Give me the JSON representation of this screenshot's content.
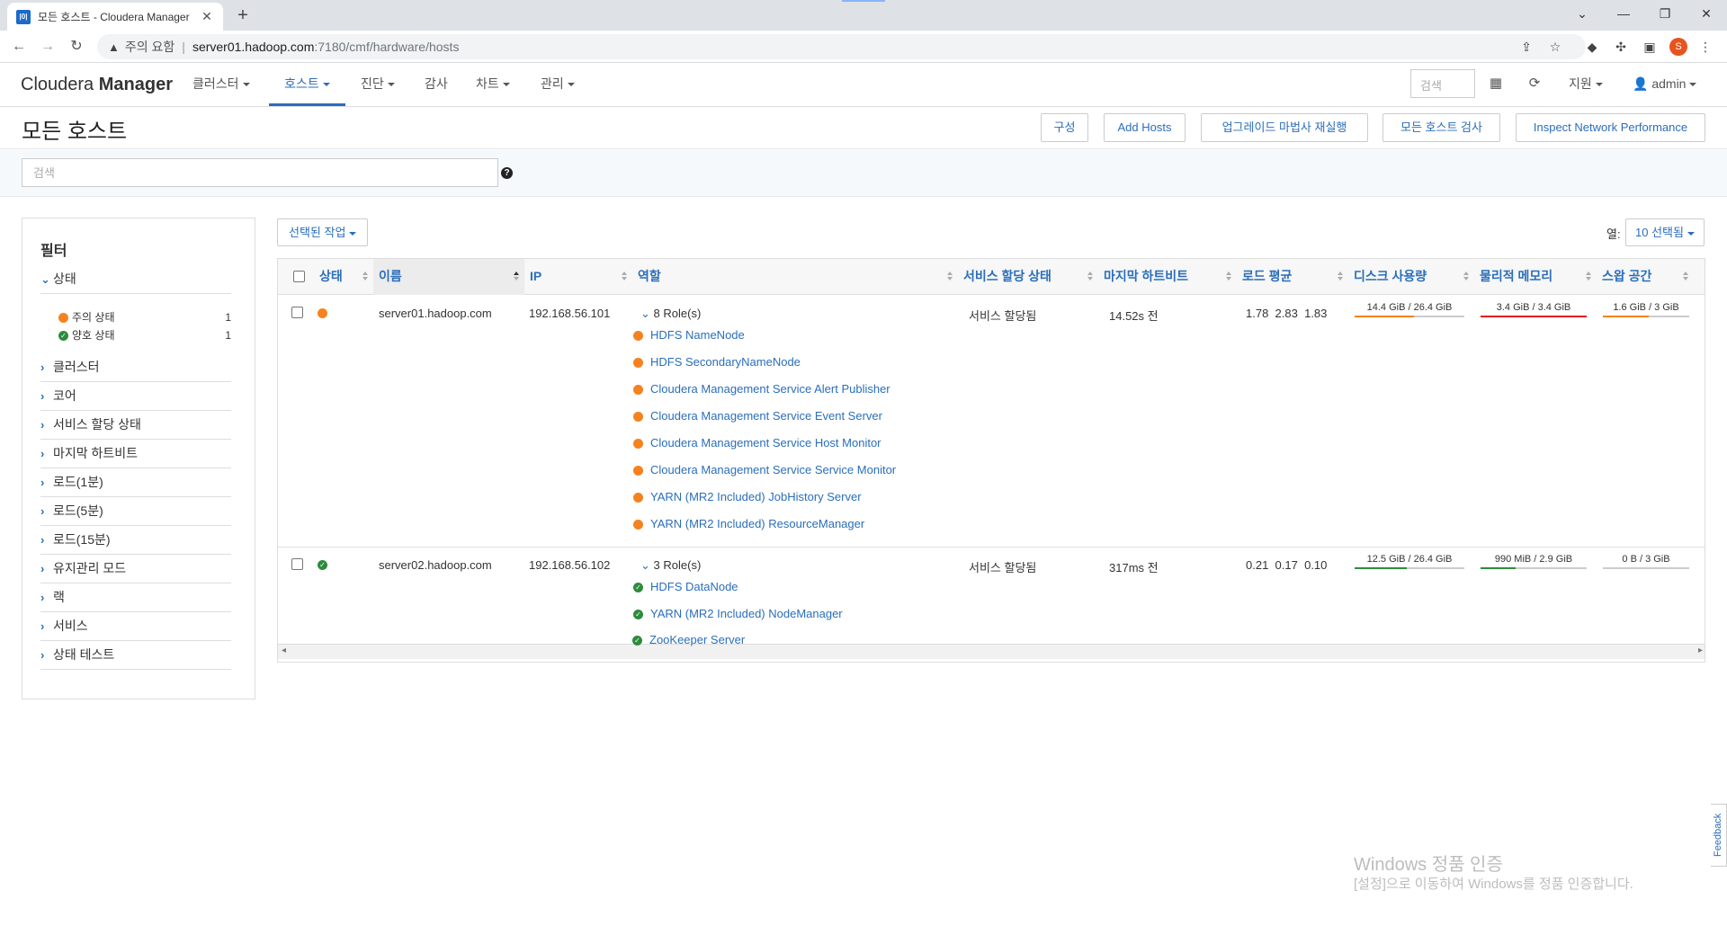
{
  "browser": {
    "tab_title": "모든 호스트 - Cloudera Manager",
    "favicon_text": "|0|",
    "new_tab": "+",
    "security_label": "주의 요함",
    "url_host": "server01.hadoop.com",
    "url_path": ":7180/cmf/hardware/hosts",
    "profile_initial": "S",
    "icons": [
      "back-icon",
      "forward-icon",
      "reload-icon",
      "share-icon",
      "star-icon",
      "extension-icon",
      "puzzle-icon",
      "sidebar-icon",
      "profile-icon",
      "menu-icon"
    ]
  },
  "app": {
    "brand_light": "Cloudera",
    "brand_bold": "Manager",
    "nav": [
      "클러스터",
      "호스트",
      "진단",
      "감사",
      "차트",
      "관리"
    ],
    "search_placeholder": "검색",
    "support": "지원",
    "user": "admin"
  },
  "page": {
    "title": "모든 호스트",
    "buttons": {
      "configure": "구성",
      "add_hosts": "Add Hosts",
      "rerun_upgrade": "업그레이드 마법사 재실행",
      "inspect_all": "모든 호스트 검사",
      "inspect_network": "Inspect Network Performance"
    },
    "search_placeholder": "검색",
    "help": "?"
  },
  "filter": {
    "title": "필터",
    "status_section": "상태",
    "status_items": [
      {
        "label": "주의 상태",
        "count": "1"
      },
      {
        "label": "양호 상태",
        "count": "1"
      }
    ],
    "sections": [
      "클러스터",
      "코어",
      "서비스 할당 상태",
      "마지막 하트비트",
      "로드(1분)",
      "로드(5분)",
      "로드(15분)",
      "유지관리 모드",
      "랙",
      "서비스",
      "상태 테스트"
    ]
  },
  "table": {
    "selected_action": "선택된 작업",
    "columns_label": "열:",
    "columns_button": "10 선택됨",
    "headers": [
      "상태",
      "이름",
      "IP",
      "역할",
      "서비스 할당 상태",
      "마지막 하트비트",
      "로드 평균",
      "디스크 사용량",
      "물리적 메모리",
      "스왑 공간"
    ],
    "rows": [
      {
        "status": "concerning",
        "name": "server01.hadoop.com",
        "ip": "192.168.56.101",
        "roles_summary": "8 Role(s)",
        "roles": [
          "HDFS NameNode",
          "HDFS SecondaryNameNode",
          "Cloudera Management Service Alert Publisher",
          "Cloudera Management Service Event Server",
          "Cloudera Management Service Host Monitor",
          "Cloudera Management Service Service Monitor",
          "YARN (MR2 Included) JobHistory Server",
          "YARN (MR2 Included) ResourceManager"
        ],
        "commission": "서비스 할당됨",
        "heartbeat": "14.52s 전",
        "load": [
          "1.78",
          "2.83",
          "1.83"
        ],
        "disk": {
          "text": "14.4 GiB / 26.4 GiB",
          "fraction": 0.545
        },
        "memory": {
          "text": "3.4 GiB / 3.4 GiB",
          "fraction": 1.0
        },
        "swap": {
          "text": "1.6 GiB / 3 GiB",
          "fraction": 0.533
        }
      },
      {
        "status": "good",
        "name": "server02.hadoop.com",
        "ip": "192.168.56.102",
        "roles_summary": "3 Role(s)",
        "roles": [
          "HDFS DataNode",
          "YARN (MR2 Included) NodeManager",
          "ZooKeeper Server"
        ],
        "commission": "서비스 할당됨",
        "heartbeat": "317ms 전",
        "load": [
          "0.21",
          "0.17",
          "0.10"
        ],
        "disk": {
          "text": "12.5 GiB / 26.4 GiB",
          "fraction": 0.473
        },
        "memory": {
          "text": "990 MiB / 2.9 GiB",
          "fraction": 0.333
        },
        "swap": {
          "text": "0 B / 3 GiB",
          "fraction": 0.0
        }
      }
    ]
  },
  "watermark": {
    "line1": "Windows 정품 인증",
    "line2": "[설정]으로 이동하여 Windows를 정품 인증합니다."
  },
  "feedback": "Feedback",
  "colors": {
    "accent": "#2a6ebb",
    "warning": "#f5821f",
    "good": "#2e8b3c",
    "bar_red": "#e02020",
    "bar_orange": "#f5821f",
    "bar_green": "#2e8b3c"
  }
}
